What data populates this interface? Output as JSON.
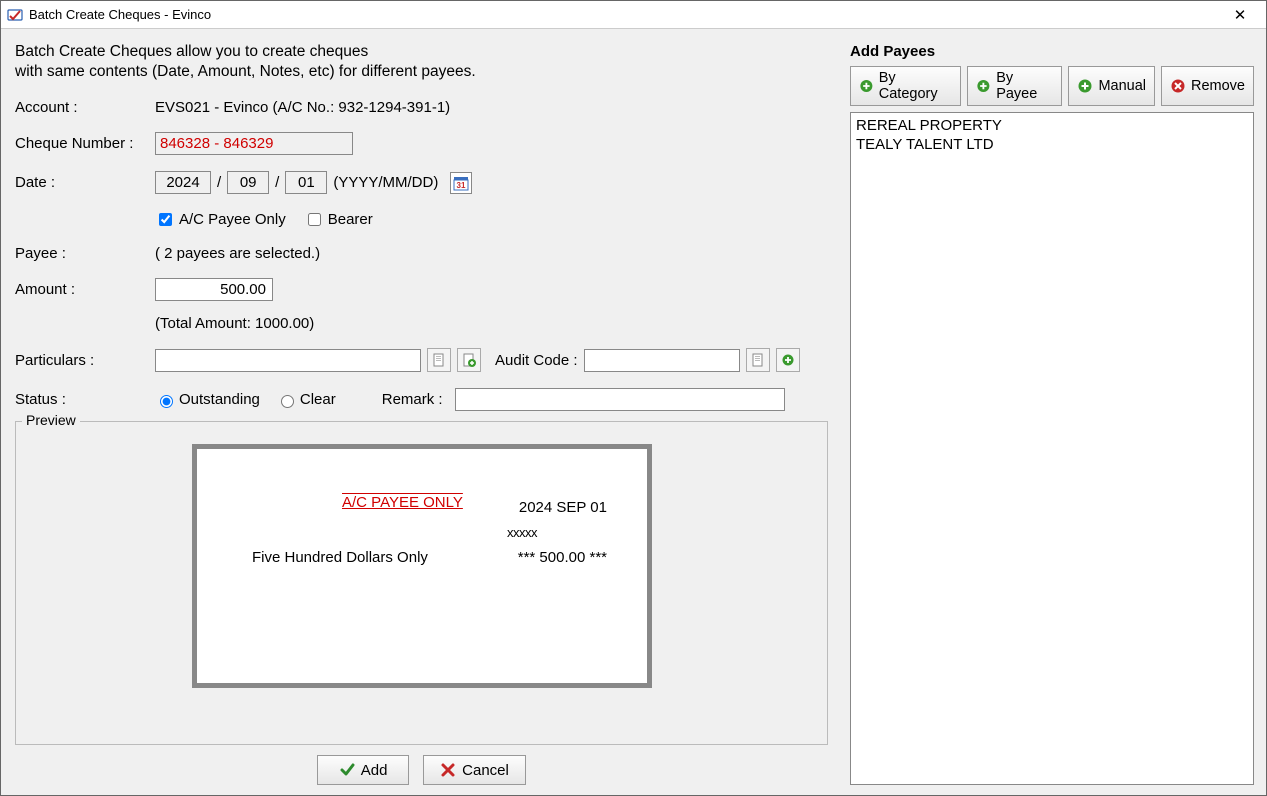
{
  "window": {
    "title": "Batch Create Cheques - Evinco"
  },
  "desc": {
    "line1": "Batch Create Cheques allow you to create cheques",
    "line2": "with same contents (Date, Amount, Notes, etc) for different payees."
  },
  "labels": {
    "account": "Account :",
    "cheque_number": "Cheque Number :",
    "date": "Date :",
    "date_hint": "(YYYY/MM/DD)",
    "ac_payee_only": "A/C Payee Only",
    "bearer": "Bearer",
    "payee": "Payee :",
    "amount": "Amount :",
    "particulars": "Particulars :",
    "audit_code": "Audit Code :",
    "status": "Status :",
    "status_outstanding": "Outstanding",
    "status_clear": "Clear",
    "remark": "Remark :",
    "preview": "Preview"
  },
  "form": {
    "account_value": "EVS021 - Evinco (A/C No.: 932-1294-391-1)",
    "cheque_range": "846328 - 846329",
    "year": "2024",
    "month": "09",
    "day": "01",
    "ac_payee_only_checked": true,
    "bearer_checked": false,
    "payee_info": "( 2 payees are selected.)",
    "amount": "500.00",
    "total_amount_label": "(Total Amount: 1000.00)",
    "particulars": "",
    "audit_code": "",
    "status": "Outstanding",
    "remark": ""
  },
  "preview": {
    "ac_payee_only": "A/C PAYEE ONLY",
    "date": "2024 SEP 01",
    "xxxxx": "xxxxx",
    "amount_words": "Five Hundred Dollars Only",
    "amount_figure": "*** 500.00 ***"
  },
  "buttons": {
    "add": "Add",
    "cancel": "Cancel"
  },
  "right": {
    "heading": "Add Payees",
    "by_category": "By Category",
    "by_payee": "By Payee",
    "manual": "Manual",
    "remove": "Remove",
    "list": [
      "REREAL PROPERTY",
      "TEALY TALENT LTD"
    ]
  }
}
